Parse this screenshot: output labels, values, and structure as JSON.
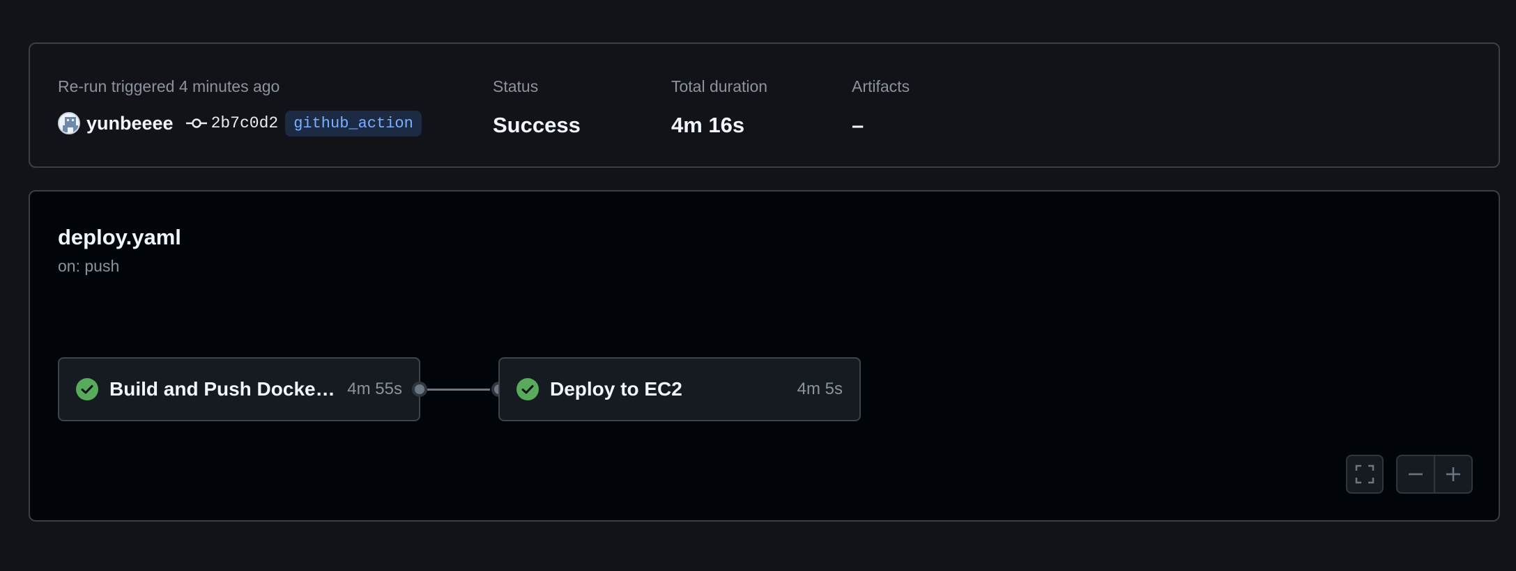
{
  "summary": {
    "trigger_label": "Re-run triggered 4 minutes ago",
    "actor": "yunbeeee",
    "commit_sha": "2b7c0d2",
    "branch": "github_action",
    "status_label": "Status",
    "status_value": "Success",
    "duration_label": "Total duration",
    "duration_value": "4m 16s",
    "artifacts_label": "Artifacts",
    "artifacts_value": "–"
  },
  "workflow": {
    "file": "deploy.yaml",
    "trigger": "on: push",
    "jobs": [
      {
        "name": "Build and Push Docker Image",
        "duration": "4m 55s",
        "status": "success"
      },
      {
        "name": "Deploy to EC2",
        "duration": "4m 5s",
        "status": "success"
      }
    ]
  },
  "colors": {
    "success": "#57ab5a",
    "background": "#111318",
    "graph_background": "#010409",
    "branch_text": "#79b0ff"
  },
  "icons": {
    "fullscreen": "fullscreen-icon",
    "zoom_out": "minus-icon",
    "zoom_in": "plus-icon",
    "commit": "git-commit-icon",
    "check": "check-circle-icon"
  }
}
